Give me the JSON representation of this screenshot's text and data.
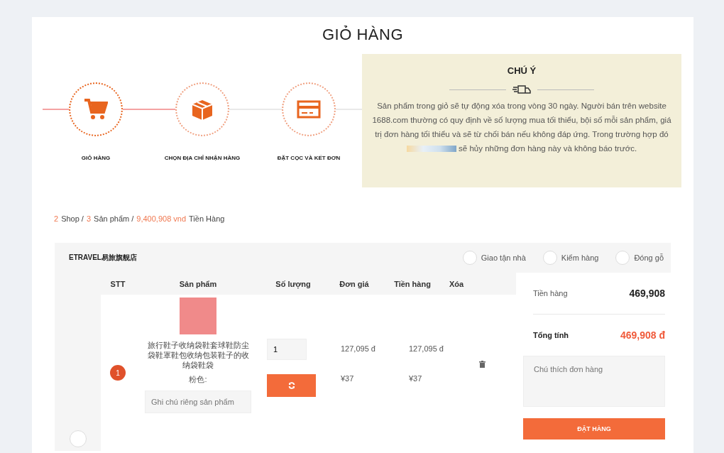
{
  "page_title": "GIỎ HÀNG",
  "steps": [
    {
      "label": "GIỎ HÀNG",
      "kind": "cart",
      "completed": true
    },
    {
      "label": "CHỌN ĐỊA CHỈ NHẬN HÀNG",
      "kind": "box",
      "completed": false
    },
    {
      "label": "ĐẶT CỌC VÀ KẾT ĐƠN",
      "kind": "card",
      "completed": false
    }
  ],
  "notice": {
    "title": "CHÚ Ý",
    "text_before": "Sản phẩm trong giỏ sẽ tự động xóa trong vòng 30 ngày. Người bán trên website 1688.com thường có quy định về số lượng mua tối thiểu, bội số mỗi sản phẩm, giá trị đơn hàng tối thiểu và sẽ từ chối bán nếu không đáp ứng. Trong trường hợp đó",
    "text_after": "sẽ hủy những đơn hàng này và không báo trước."
  },
  "summary": [
    {
      "text": "2",
      "highlight": true
    },
    {
      "text": "Shop /",
      "highlight": false
    },
    {
      "text": "3",
      "highlight": true
    },
    {
      "text": "Sản phẩm /",
      "highlight": false
    },
    {
      "text": "9,400,908 vnd",
      "highlight": true
    },
    {
      "text": "Tiền Hàng",
      "highlight": false
    }
  ],
  "shop": {
    "name": "ETRAVEL易旅旗舰店",
    "options": [
      {
        "label": "Giao tận nhà",
        "checked": false
      },
      {
        "label": "Kiểm hàng",
        "checked": false
      },
      {
        "label": "Đóng gỗ",
        "checked": false
      }
    ],
    "columns": [
      "STT",
      "Sản phẩm",
      "Số lượng",
      "Đơn giá",
      "Tiền hàng",
      "Xóa"
    ],
    "items": [
      {
        "index": "1",
        "name": "旅行鞋子收纳袋鞋套球鞋防尘袋鞋罩鞋包收纳包装鞋子的收纳袋鞋袋",
        "variant": "粉色:",
        "note_placeholder": "Ghi chú riêng sản phẩm",
        "quantity": "1",
        "unit_price_vnd": "127,095 đ",
        "unit_price_cny": "¥37",
        "total_vnd": "127,095 đ",
        "total_cny": "¥37"
      }
    ],
    "selected": false,
    "totals": {
      "subtotal_label": "Tiền hàng",
      "subtotal": "469,908",
      "total_label": "Tổng tính",
      "total": "469,908 đ",
      "note_placeholder": "Chú thích đơn hàng",
      "order_button": "ĐẶT HÀNG"
    }
  }
}
